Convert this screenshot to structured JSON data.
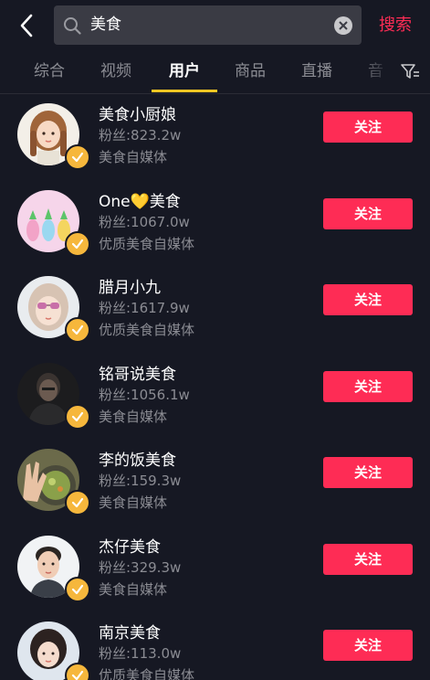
{
  "header": {
    "search_query": "美食",
    "search_button": "搜索"
  },
  "tabs": [
    {
      "label": "综合"
    },
    {
      "label": "视频"
    },
    {
      "label": "用户"
    },
    {
      "label": "商品"
    },
    {
      "label": "直播"
    },
    {
      "label": "音"
    }
  ],
  "active_tab": "用户",
  "users": [
    {
      "name": "美食小厨娘",
      "fans": "粉丝:823.2w",
      "desc": "美食自媒体",
      "follow": "关注"
    },
    {
      "name": "One💛美食",
      "fans": "粉丝:1067.0w",
      "desc": "优质美食自媒体",
      "follow": "关注"
    },
    {
      "name": "腊月小九",
      "fans": "粉丝:1617.9w",
      "desc": "优质美食自媒体",
      "follow": "关注"
    },
    {
      "name": "铭哥说美食",
      "fans": "粉丝:1056.1w",
      "desc": "美食自媒体",
      "follow": "关注"
    },
    {
      "name": "李的饭美食",
      "fans": "粉丝:159.3w",
      "desc": "美食自媒体",
      "follow": "关注"
    },
    {
      "name": "杰仔美食",
      "fans": "粉丝:329.3w",
      "desc": "美食自媒体",
      "follow": "关注"
    },
    {
      "name": "南京美食",
      "fans": "粉丝:113.0w",
      "desc": "优质美食自媒体",
      "follow": "关注"
    }
  ],
  "colors": {
    "background": "#161823",
    "accent_red": "#fe2c55",
    "tab_indicator": "#f5c623",
    "verified_badge": "#f6b73c",
    "secondary_text": "#8b8c93"
  },
  "icons": {
    "back": "chevron-left-icon",
    "search": "search-icon",
    "clear": "clear-icon",
    "filter": "filter-icon",
    "verified": "verified-check-icon"
  }
}
